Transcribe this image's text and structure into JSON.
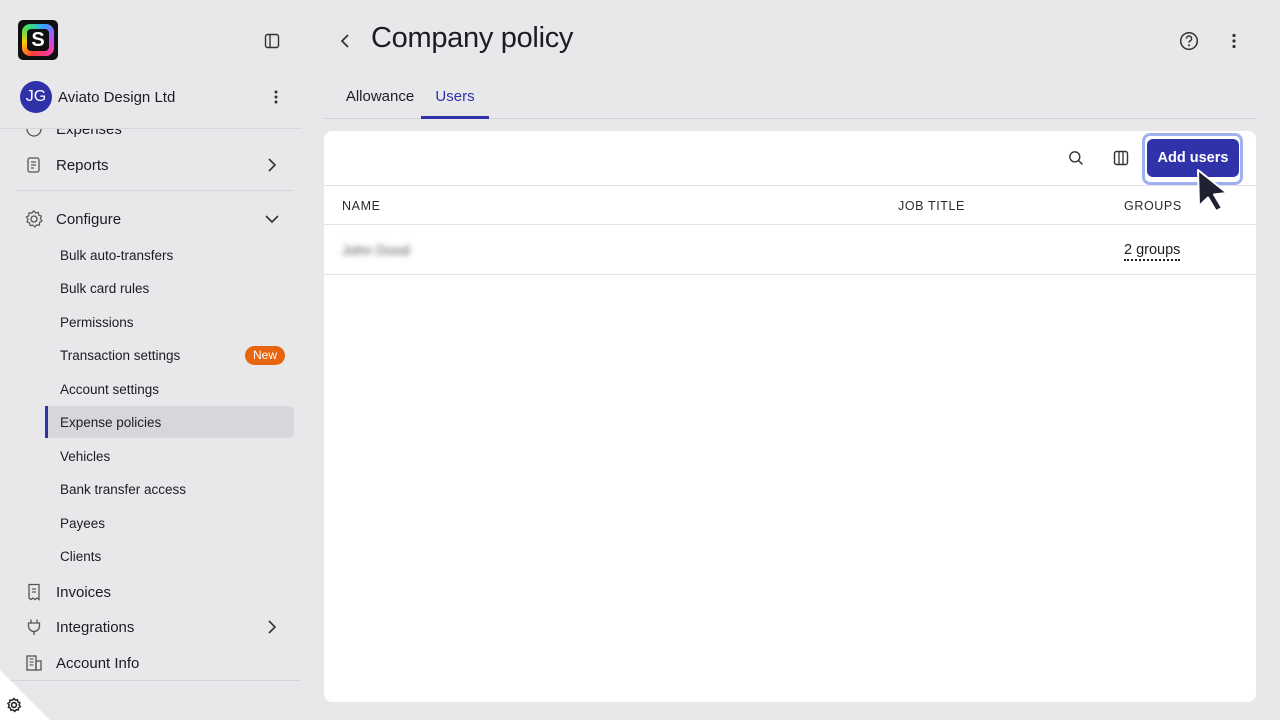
{
  "sidebar": {
    "logo_letter": "S",
    "org": {
      "initials": "JG",
      "name": "Aviato Design Ltd"
    },
    "partial_item": "Expenses",
    "items": {
      "reports": "Reports",
      "configure": "Configure",
      "invoices": "Invoices",
      "integrations": "Integrations",
      "account_info": "Account Info"
    },
    "configure_sub": [
      "Bulk auto-transfers",
      "Bulk card rules",
      "Permissions",
      "Transaction settings",
      "Account settings",
      "Expense policies",
      "Vehicles",
      "Bank transfer access",
      "Payees",
      "Clients"
    ],
    "new_badge": "New"
  },
  "header": {
    "title": "Company policy"
  },
  "tabs": {
    "allowance": "Allowance",
    "users": "Users"
  },
  "toolbar": {
    "add_label": "Add users"
  },
  "table": {
    "columns": {
      "name": "NAME",
      "job_title": "JOB TITLE",
      "groups": "GROUPS"
    },
    "rows": [
      {
        "name": "John Dood",
        "job_title": "",
        "groups": "2 groups"
      }
    ]
  },
  "colors": {
    "accent": "#2f32a9",
    "badge": "#e8650f",
    "background": "#e8e8ea"
  }
}
